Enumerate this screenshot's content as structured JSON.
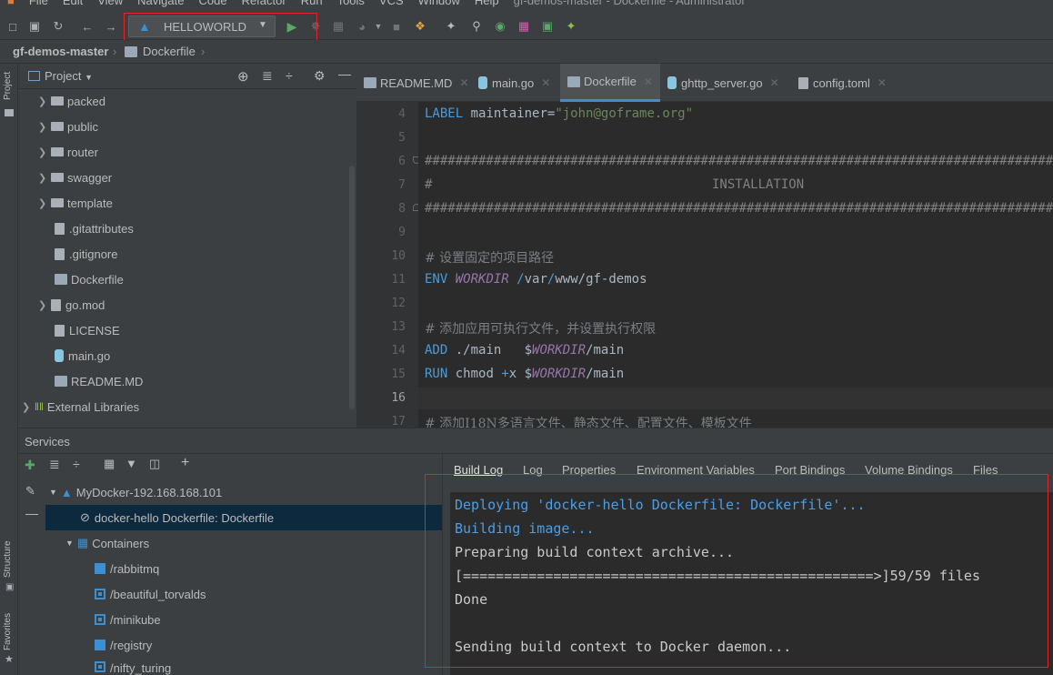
{
  "menu": [
    "File",
    "Edit",
    "View",
    "Navigate",
    "Code",
    "Refactor",
    "Run",
    "Tools",
    "VCS",
    "Window",
    "Help"
  ],
  "window_title": "gf-demos-master - Dockerfile - Administrator",
  "toolbar": {
    "run_config": "HELLOWORLD"
  },
  "breadcrumb": {
    "project": "gf-demos-master",
    "file": "Dockerfile"
  },
  "left_strip": {
    "project": "Project",
    "structure": "Structure",
    "favorites": "Favorites"
  },
  "project_panel": {
    "title": "Project",
    "items": [
      {
        "label": "packed",
        "type": "folder"
      },
      {
        "label": "public",
        "type": "folder"
      },
      {
        "label": "router",
        "type": "folder"
      },
      {
        "label": "swagger",
        "type": "folder"
      },
      {
        "label": "template",
        "type": "folder"
      },
      {
        "label": ".gitattributes",
        "type": "file"
      },
      {
        "label": ".gitignore",
        "type": "file"
      },
      {
        "label": "Dockerfile",
        "type": "docker"
      },
      {
        "label": "go.mod",
        "type": "file"
      },
      {
        "label": "LICENSE",
        "type": "file"
      },
      {
        "label": "main.go",
        "type": "go"
      },
      {
        "label": "README.MD",
        "type": "md"
      },
      {
        "label": "External Libraries",
        "type": "lib"
      }
    ]
  },
  "editor": {
    "tabs": [
      "README.MD",
      "main.go",
      "Dockerfile",
      "ghttp_server.go",
      "config.toml"
    ],
    "active_tab": "Dockerfile",
    "line_numbers": [
      "4",
      "5",
      "6",
      "7",
      "8",
      "9",
      "10",
      "11",
      "12",
      "13",
      "14",
      "15",
      "16",
      "17"
    ],
    "lines": {
      "l4_kw": "LABEL",
      "l4_rest": " maintainer=",
      "l4_str": "\"john@goframe.org\"",
      "l6": "####################################################################################",
      "l7_hash": "#",
      "l7_text": "INSTALLATION",
      "l8": "####################################################################################",
      "l10": "# 设置固定的项目路径",
      "l11_kw": "ENV",
      "l11_var": "WORKDIR",
      "l11_path1": " /",
      "l11_path2": "var",
      "l11_path3": "/",
      "l11_path4": "www",
      "l11_path5": "/gf-demos",
      "l13": "# 添加应用可执行文件，并设置执行权限",
      "l14_kw": "ADD",
      "l14_a": " ./main   $",
      "l14_var": "WORKDIR",
      "l14_b": "/main",
      "l15_kw": "RUN",
      "l15_a": " chmod ",
      "l15_plus": "+",
      "l15_b": "x $",
      "l15_var": "WORKDIR",
      "l15_c": "/main",
      "l17": "# 添加I18N多语言文件、静态文件、配置文件、模板文件"
    }
  },
  "services": {
    "title": "Services",
    "tree": {
      "connection": "MyDocker-192.168.168.101",
      "deployment": "docker-hello Dockerfile: Dockerfile",
      "containers_label": "Containers",
      "containers": [
        "/rabbitmq",
        "/beautiful_torvalds",
        "/minikube",
        "/registry",
        "/nifty_turing"
      ]
    },
    "tabs": [
      "Build Log",
      "Log",
      "Properties",
      "Environment Variables",
      "Port Bindings",
      "Volume Bindings",
      "Files"
    ],
    "active_tab": "Build Log",
    "log": [
      "Deploying 'docker-hello Dockerfile: Dockerfile'...",
      "Building image...",
      "Preparing build context archive...",
      "[==================================================>]59/59 files",
      "Done",
      "",
      "Sending build context to Docker daemon..."
    ]
  },
  "colors": {
    "accent": "#4a88c7",
    "highlight_box": "#e0242c",
    "log_blue": "#4a9eea"
  }
}
